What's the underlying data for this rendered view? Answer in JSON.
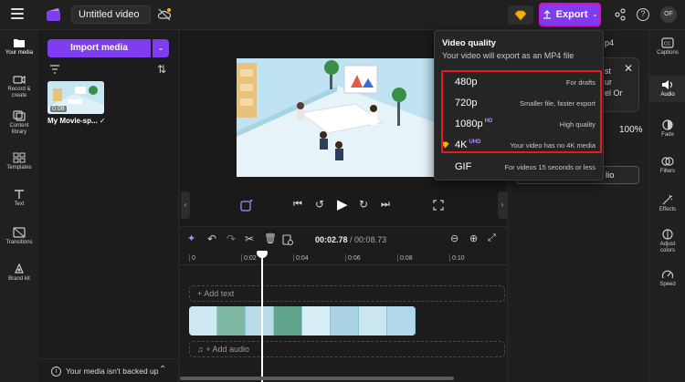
{
  "app": {
    "title": "Untitled video",
    "export_label": "Export",
    "avatar_initials": "OF",
    "accent": "#7f3cf0",
    "export_border": "#d60fd8"
  },
  "leftnav": {
    "items": [
      {
        "label_1": "Your media",
        "label_2": "",
        "icon": "folder-icon"
      },
      {
        "label_1": "Record &",
        "label_2": "create",
        "icon": "camera-icon"
      },
      {
        "label_1": "Content",
        "label_2": "library",
        "icon": "library-icon"
      },
      {
        "label_1": "Templates",
        "label_2": "",
        "icon": "templates-icon"
      },
      {
        "label_1": "Text",
        "label_2": "",
        "icon": "text-icon"
      },
      {
        "label_1": "Transitions",
        "label_2": "",
        "icon": "transitions-icon"
      },
      {
        "label_1": "Brand kit",
        "label_2": "",
        "icon": "brand-kit-icon"
      }
    ]
  },
  "media": {
    "import_label": "Import media",
    "thumb_duration": "0:08",
    "item_name": "My Movie-sp...",
    "backup_text": "Your media isn't backed up"
  },
  "timeline": {
    "current_time": "00:02.78",
    "total_time": "/ 00:08.73",
    "ticks": [
      "0",
      "0:02",
      "0:04",
      "0:06",
      "0:08",
      "0:10"
    ],
    "add_text": "+ Add text",
    "add_audio": "+ Add audio",
    "playhead_fraction": 0.318
  },
  "rightrail": {
    "items": [
      {
        "label_1": "Captions",
        "label_2": "",
        "icon": "captions-icon"
      },
      {
        "label_1": "Audio",
        "label_2": "",
        "icon": "speaker-icon"
      },
      {
        "label_1": "Fade",
        "label_2": "",
        "icon": "fade-icon"
      },
      {
        "label_1": "Filters",
        "label_2": "",
        "icon": "filters-icon"
      },
      {
        "label_1": "Effects",
        "label_2": "",
        "icon": "effects-icon"
      },
      {
        "label_1": "Adjust",
        "label_2": "colors",
        "icon": "adjust-colors-icon"
      },
      {
        "label_1": "Speed",
        "label_2": "",
        "icon": "speed-icon"
      }
    ]
  },
  "props": {
    "fragment_1": "p4",
    "fragment_2": "st",
    "fragment_3": "ur",
    "fragment_4": "el Or",
    "volume": "100%",
    "button_fragment": "lio"
  },
  "export_menu": {
    "title": "Video quality",
    "subtitle": "Your video will export as an MP4 file",
    "options": [
      {
        "label": "480p",
        "badge": "",
        "desc": "For drafts"
      },
      {
        "label": "720p",
        "badge": "",
        "desc": "Smaller file, faster export"
      },
      {
        "label": "1080p",
        "badge": "HD",
        "desc": "High quality"
      },
      {
        "label": "4K",
        "badge": "UHD",
        "desc": "Your video has no 4K media"
      },
      {
        "label": "GIF",
        "badge": "",
        "desc": "For videos 15 seconds or less"
      }
    ]
  }
}
